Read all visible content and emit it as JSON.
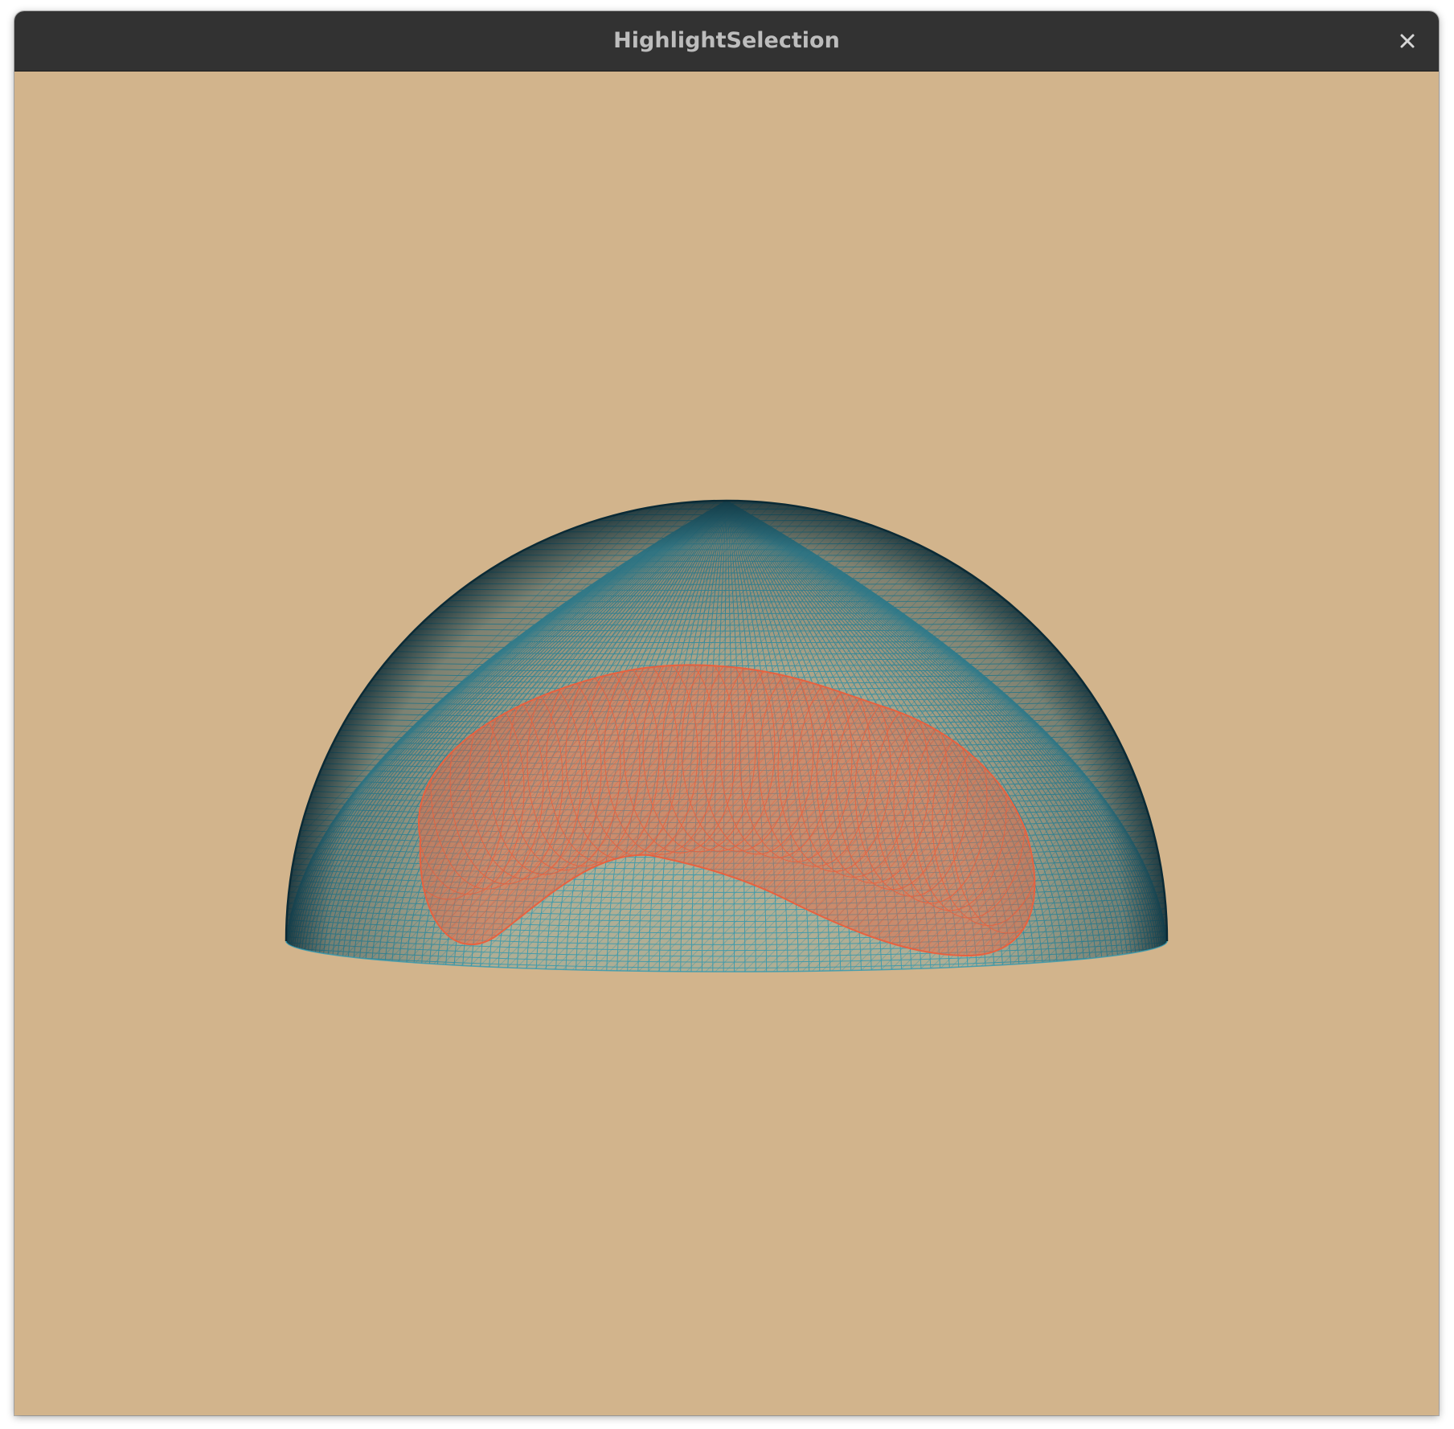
{
  "window": {
    "title": "HighlightSelection",
    "close_icon": "close-icon"
  },
  "scene": {
    "background_color": "#d2b48c",
    "mesh_color": "#2f98b0",
    "mesh_edge_color": "#0b2a35",
    "selection_color": "#e8613f",
    "object": "hemisphere wireframe",
    "selection": "highlighted region"
  }
}
